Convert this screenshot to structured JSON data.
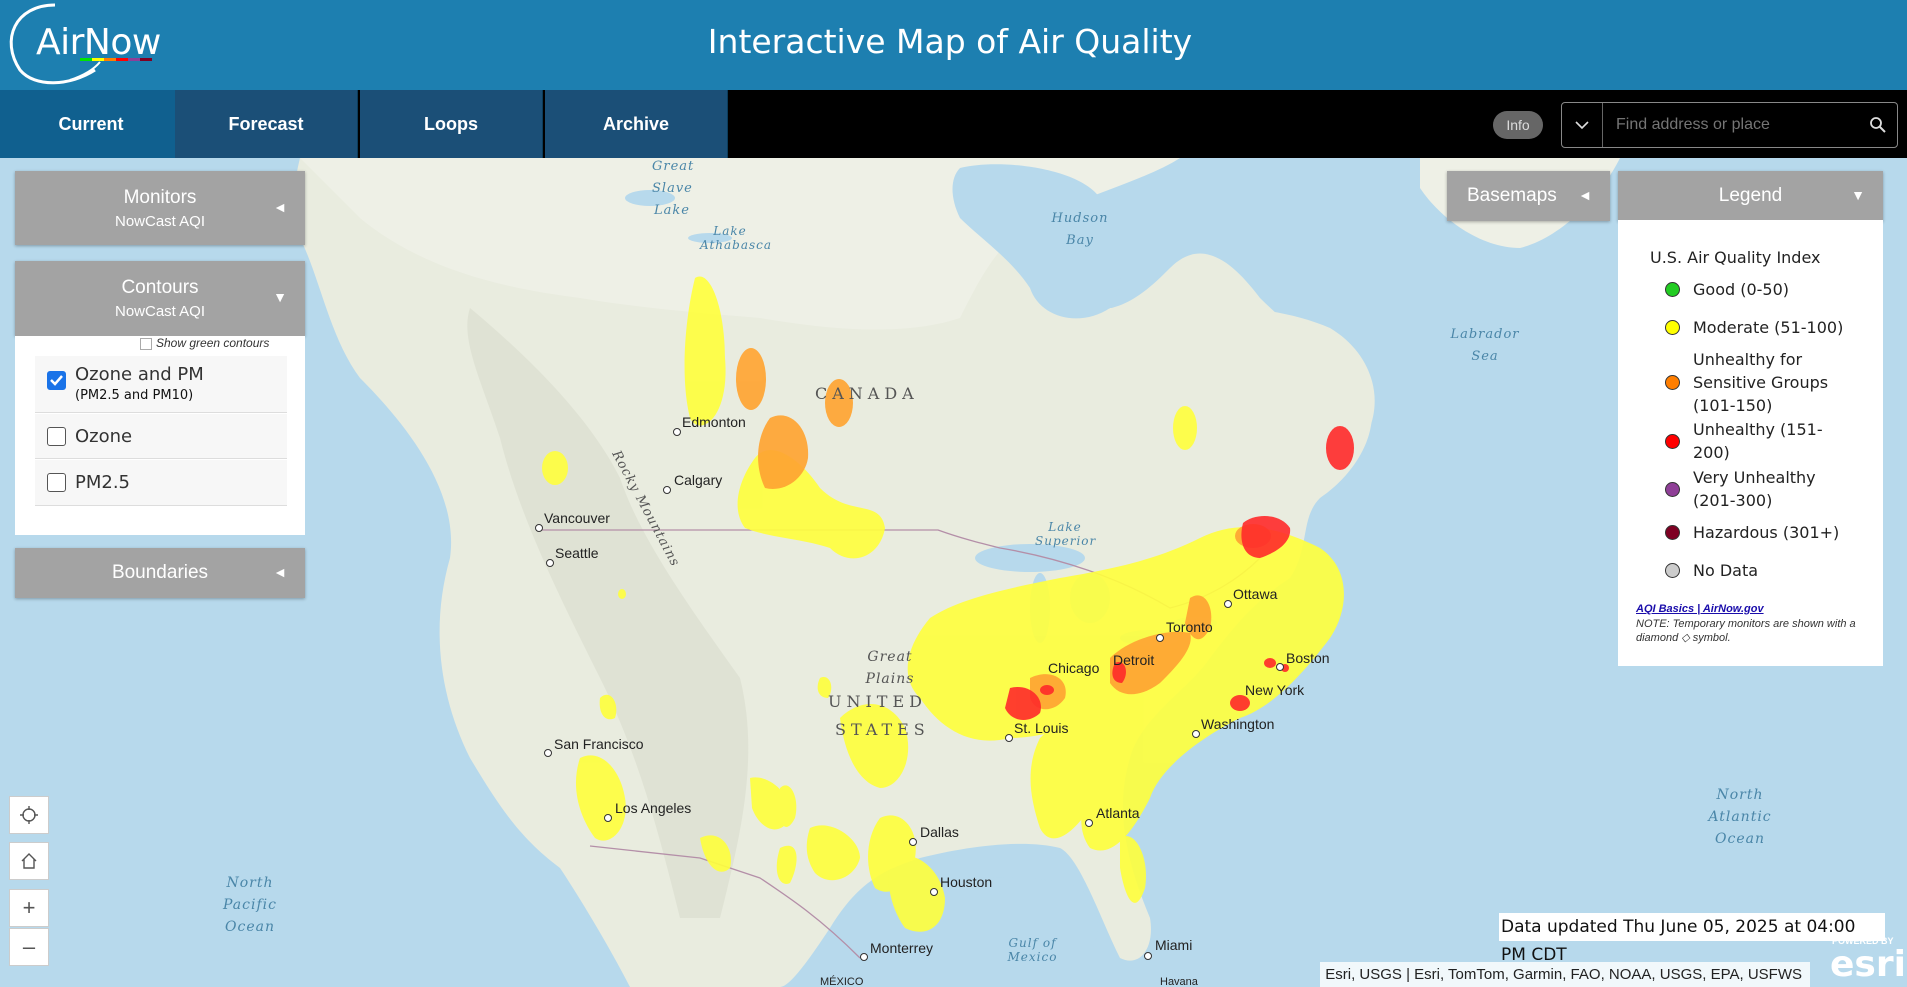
{
  "app": {
    "logo_text": "AirNow",
    "title": "Interactive Map of Air Quality"
  },
  "nav": {
    "tabs": [
      {
        "label": "Current",
        "active": true
      },
      {
        "label": "Forecast",
        "active": false
      },
      {
        "label": "Loops",
        "active": false
      },
      {
        "label": "Archive",
        "active": false
      }
    ],
    "info_label": "Info",
    "search_placeholder": "Find address or place"
  },
  "panels": {
    "monitors": {
      "title": "Monitors",
      "subtitle": "NowCast AQI",
      "arrow": "◄"
    },
    "contours": {
      "title": "Contours",
      "subtitle": "NowCast AQI",
      "arrow": "▼",
      "show_green_label": "Show green contours",
      "show_green_checked": false,
      "layers": [
        {
          "label": "Ozone and PM",
          "sublabel": "(PM2.5 and PM10)",
          "checked": true
        },
        {
          "label": "Ozone",
          "sublabel": "",
          "checked": false
        },
        {
          "label": "PM2.5",
          "sublabel": "",
          "checked": false
        }
      ]
    },
    "boundaries": {
      "title": "Boundaries",
      "arrow": "◄"
    },
    "basemaps": {
      "title": "Basemaps",
      "arrow": "◄"
    },
    "legend": {
      "title": "Legend",
      "arrow": "▼",
      "heading": "U.S. Air Quality Index",
      "items": [
        {
          "label": "Good (0-50)",
          "color": "#22cc22"
        },
        {
          "label": "Moderate (51-100)",
          "color": "#ffff00"
        },
        {
          "label": "Unhealthy for Sensitive Groups (101-150)",
          "color": "#ff7e00"
        },
        {
          "label": "Unhealthy (151-200)",
          "color": "#ff0000"
        },
        {
          "label": "Very Unhealthy (201-300)",
          "color": "#8f3f97"
        },
        {
          "label": "Hazardous (301+)",
          "color": "#7e0023"
        },
        {
          "label": "No Data",
          "color": "#cccccc"
        }
      ],
      "link_text": "AQI Basics | AirNow.gov",
      "note": "NOTE: Temporary monitors are shown with a diamond ◇ symbol."
    }
  },
  "map": {
    "water_labels": {
      "great_slave_lake": "Great Slave Lake",
      "lake_athabasca": "Lake Athabasca",
      "hudson_bay": "Hudson Bay",
      "labrador_sea": "Labrador Sea",
      "lake_superior": "Lake Superior",
      "gulf_of_mexico": "Gulf of Mexico",
      "north_pacific": "North Pacific Ocean",
      "north_atlantic": "North Atlantic Ocean"
    },
    "region_labels": {
      "canada": "CANADA",
      "united": "UNITED",
      "states": "STATES",
      "rocky_mountains": "Rocky Mountains",
      "great_plains": "Great Plains"
    },
    "cities": {
      "edmonton": "Edmonton",
      "calgary": "Calgary",
      "vancouver": "Vancouver",
      "seattle": "Seattle",
      "san_francisco": "San Francisco",
      "los_angeles": "Los Angeles",
      "dallas": "Dallas",
      "houston": "Houston",
      "monterrey": "Monterrey",
      "st_louis": "St. Louis",
      "chicago": "Chicago",
      "detroit": "Detroit",
      "toronto": "Toronto",
      "ottawa": "Ottawa",
      "boston": "Boston",
      "new_york": "New York",
      "washington": "Washington",
      "atlanta": "Atlanta",
      "miami": "Miami",
      "mexico": "MÉXICO",
      "havana": "Havana"
    },
    "controls": {
      "locate_icon": "crosshair-icon",
      "home_icon": "home-icon",
      "zoom_in": "+",
      "zoom_out": "–"
    },
    "updated": "Data updated Thu June 05, 2025 at 04:00 PM CDT",
    "attribution": "Esri, USGS | Esri, TomTom, Garmin, FAO, NOAA, USGS, EPA, USFWS",
    "esri_powered": "POWERED BY",
    "esri_logo": "esri"
  },
  "colors": {
    "header": "#1d7fb0",
    "tab_active": "#10608f",
    "tab": "#1b4f77",
    "panel": "#a3a3a3",
    "moderate": "#ffff00",
    "usg": "#ff9933",
    "unhealthy": "#ff2020"
  }
}
